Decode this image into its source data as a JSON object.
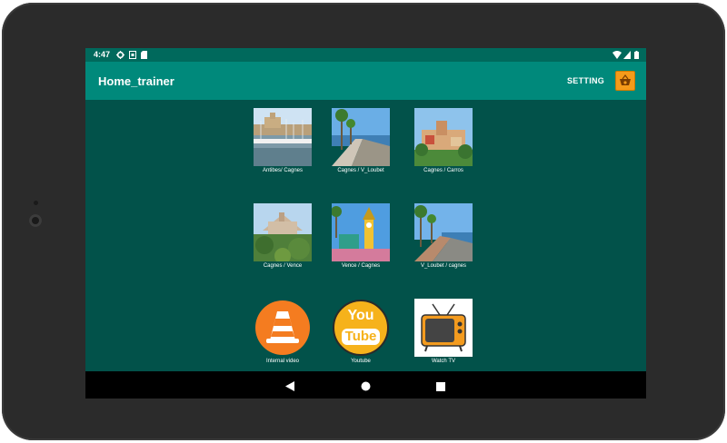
{
  "status_bar": {
    "time": "4:47",
    "left_icons": [
      "gear-icon",
      "notification-icon",
      "sd-card-icon"
    ],
    "right_icons": [
      "wifi-icon",
      "signal-icon",
      "battery-icon"
    ]
  },
  "app_bar": {
    "title": "Home_trainer",
    "setting_label": "SETTING",
    "setting_icon": "setting-basket-icon"
  },
  "tiles": [
    {
      "label": "Antibes/ Cagnes"
    },
    {
      "label": "Cagnes / V_Loubet"
    },
    {
      "label": "Cagnes / Carros"
    },
    {
      "label": "Cagnes / Vence"
    },
    {
      "label": "Vence / Cagnes"
    },
    {
      "label": "V_Loubet / cagnes"
    },
    {
      "label": "Internal video"
    },
    {
      "label": "Youtube"
    },
    {
      "label": "Watch TV"
    }
  ],
  "youtube_logo": {
    "line1": "You",
    "line2": "Tube"
  },
  "nav_bar": {
    "icons": [
      "back-icon",
      "home-icon",
      "recents-icon"
    ]
  },
  "colors": {
    "status_bar": "#00695c",
    "app_bar": "#00897b",
    "background": "#02524a",
    "accent": "#f59b1a"
  }
}
